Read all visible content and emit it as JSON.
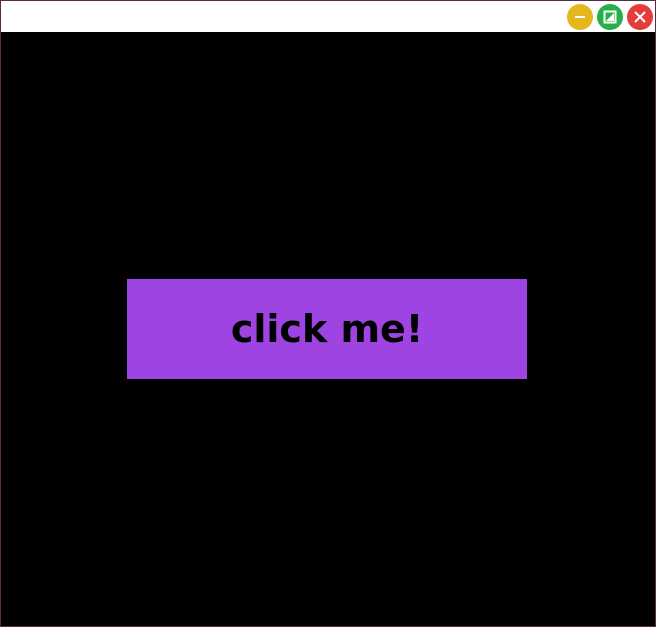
{
  "window": {
    "controls": {
      "minimize_icon": "minimize-icon",
      "maximize_icon": "maximize-icon",
      "close_icon": "close-icon",
      "minimize_color": "#e5b71c",
      "maximize_color": "#27b04a",
      "close_color": "#e63b3b"
    },
    "background_color": "#000000"
  },
  "main": {
    "button_label": "click me!",
    "button_color": "#9d44e2",
    "button_text_color": "#000000"
  }
}
